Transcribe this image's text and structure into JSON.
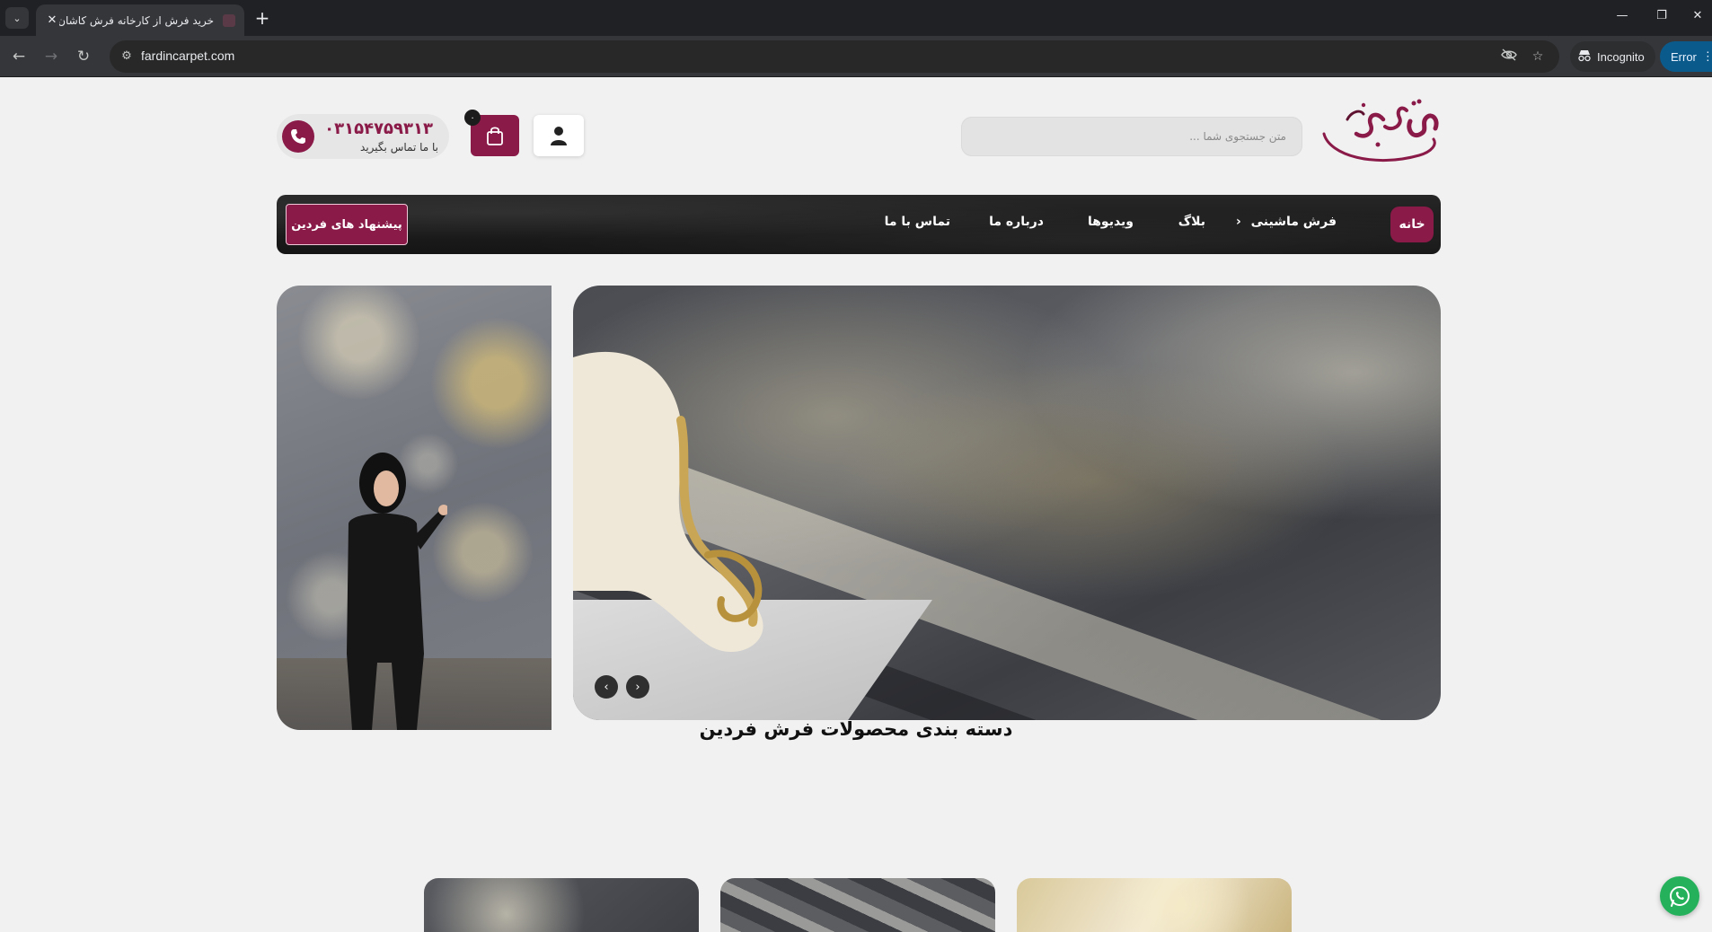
{
  "browser": {
    "tab_title": "خرید فرش از کارخانه فرش کاشان|",
    "url": "fardincarpet.com",
    "incognito_label": "Incognito",
    "error_label": "Error"
  },
  "header": {
    "search_placeholder": "متن جستجوی شما ...",
    "cart_count": "۰",
    "phone_number": "۰۳۱۵۴۷۵۹۳۱۳",
    "contact_label": "با ما تماس بگیرید"
  },
  "nav": {
    "home": "خانه",
    "machine_carpet": "فرش ماشینی",
    "blog": "بلاگ",
    "videos": "ویدیوها",
    "about": "درباره ما",
    "contact": "تماس با ما",
    "offers": "پیشنهاد های فردین"
  },
  "section": {
    "categories_title": "دسته بندی محصولات فرش فردین"
  },
  "colors": {
    "brand": "#8a1a48",
    "whatsapp": "#25b05c"
  },
  "icons": {
    "user": "user-icon",
    "cart": "shopping-bag-icon",
    "phone": "phone-icon",
    "whatsapp": "whatsapp-icon"
  }
}
